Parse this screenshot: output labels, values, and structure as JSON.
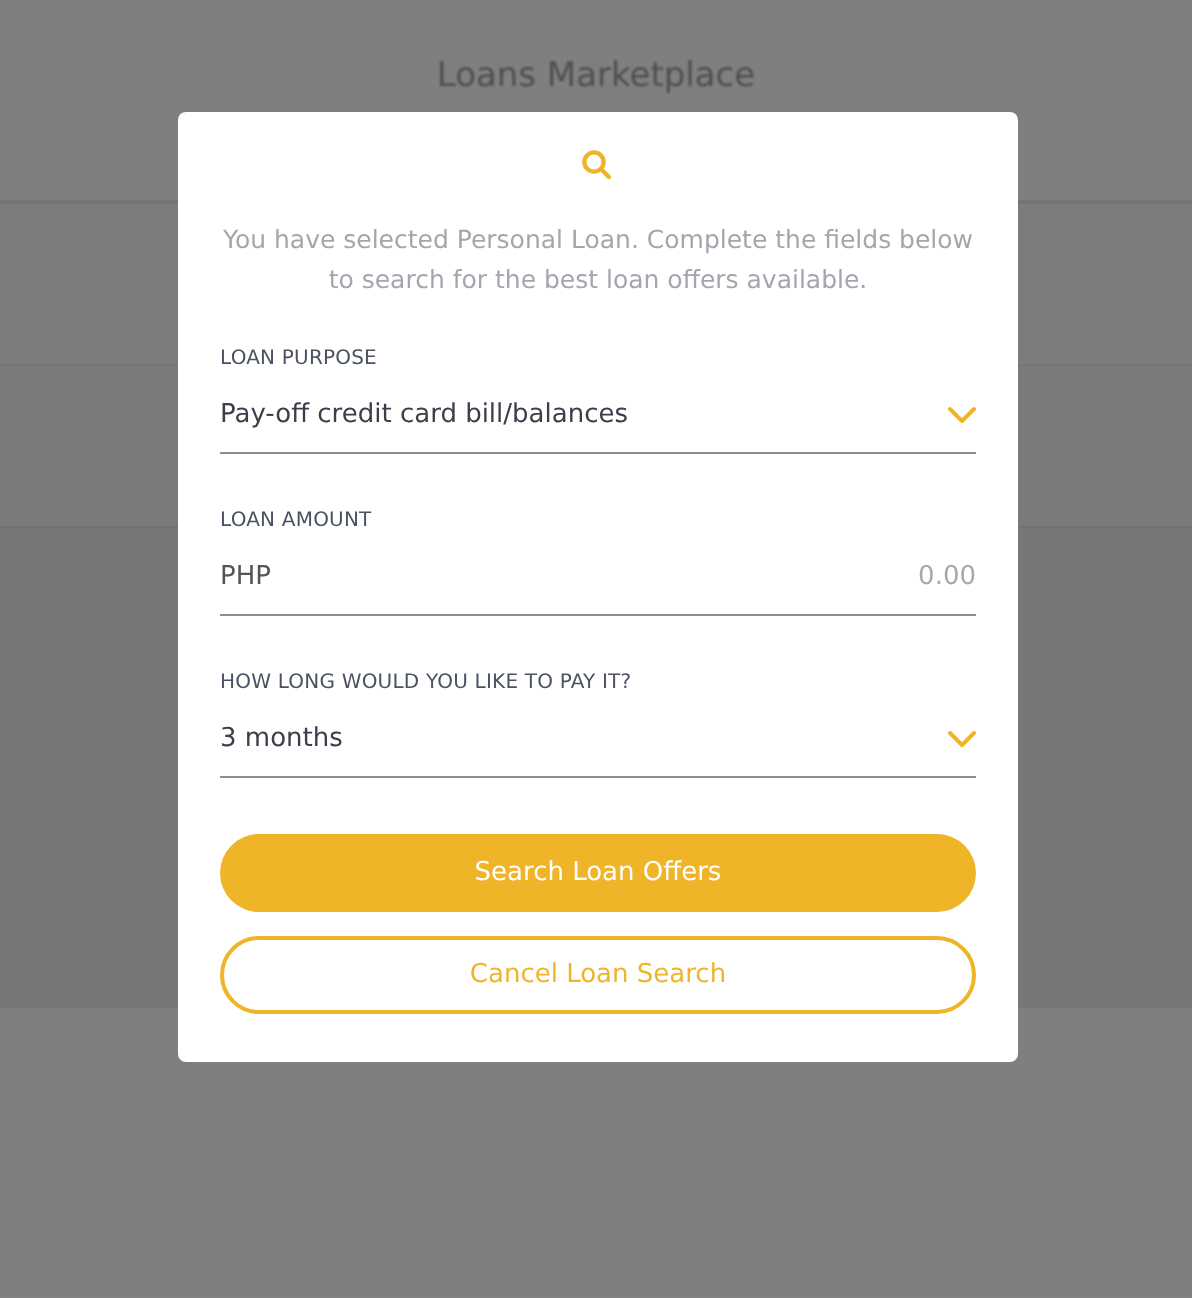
{
  "page_title": "Loans Marketplace",
  "dialog": {
    "description": "You have selected Personal Loan. Complete the fields below to search for the best loan offers available.",
    "fields": [
      {
        "kind": "select",
        "label": "LOAN PURPOSE",
        "value": "Pay-off credit card bill/balances"
      },
      {
        "kind": "amount",
        "label": "LOAN AMOUNT",
        "prefix": "PHP",
        "placeholder": "0.00"
      },
      {
        "kind": "select",
        "label": "HOW LONG WOULD YOU LIKE TO PAY IT?",
        "value": "3 months"
      }
    ],
    "buttons": [
      {
        "kind": "primary",
        "label": "Search Loan Offers"
      },
      {
        "kind": "secondary",
        "label": "Cancel Loan Search"
      }
    ]
  }
}
